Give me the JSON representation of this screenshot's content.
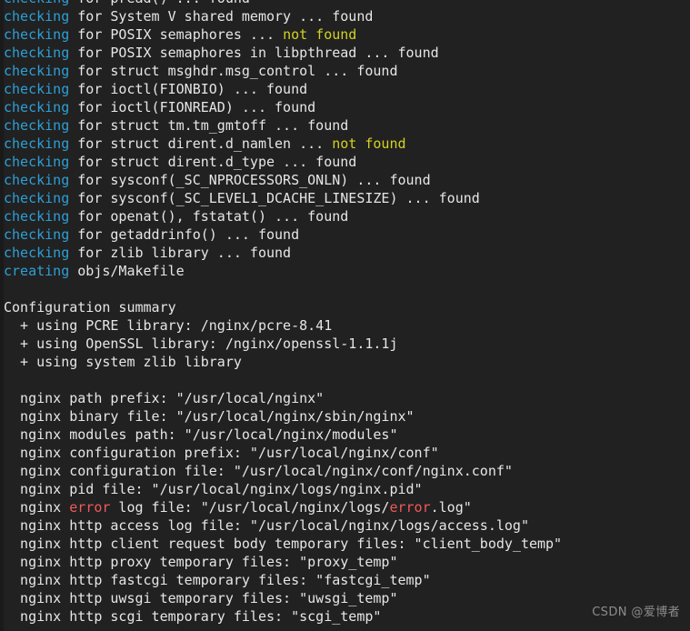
{
  "terminal": {
    "background_color": "#212121",
    "default_text_color": "#e6e6e6",
    "accent_colors": {
      "cyan": "#2d9fd6",
      "yellow": "#d2d222",
      "red": "#f05a5a",
      "watermark": "#8c8c8c"
    },
    "lines": [
      {
        "kind": "clipped",
        "segments": [
          {
            "text": "checking",
            "color": "cyan"
          },
          {
            "text": " for pread() ... found",
            "color": "default"
          }
        ]
      },
      {
        "kind": "text",
        "segments": [
          {
            "text": "checking",
            "color": "cyan"
          },
          {
            "text": " for System V shared memory ... found",
            "color": "default"
          }
        ]
      },
      {
        "kind": "text",
        "segments": [
          {
            "text": "checking",
            "color": "cyan"
          },
          {
            "text": " for POSIX semaphores ... ",
            "color": "default"
          },
          {
            "text": "not found",
            "color": "yellow"
          }
        ]
      },
      {
        "kind": "text",
        "segments": [
          {
            "text": "checking",
            "color": "cyan"
          },
          {
            "text": " for POSIX semaphores in libpthread ... found",
            "color": "default"
          }
        ]
      },
      {
        "kind": "text",
        "segments": [
          {
            "text": "checking",
            "color": "cyan"
          },
          {
            "text": " for struct msghdr.msg_control ... found",
            "color": "default"
          }
        ]
      },
      {
        "kind": "text",
        "segments": [
          {
            "text": "checking",
            "color": "cyan"
          },
          {
            "text": " for ioctl(FIONBIO) ... found",
            "color": "default"
          }
        ]
      },
      {
        "kind": "text",
        "segments": [
          {
            "text": "checking",
            "color": "cyan"
          },
          {
            "text": " for ioctl(FIONREAD) ... found",
            "color": "default"
          }
        ]
      },
      {
        "kind": "text",
        "segments": [
          {
            "text": "checking",
            "color": "cyan"
          },
          {
            "text": " for struct tm.tm_gmtoff ... found",
            "color": "default"
          }
        ]
      },
      {
        "kind": "text",
        "segments": [
          {
            "text": "checking",
            "color": "cyan"
          },
          {
            "text": " for struct dirent.d_namlen ... ",
            "color": "default"
          },
          {
            "text": "not found",
            "color": "yellow"
          }
        ]
      },
      {
        "kind": "text",
        "segments": [
          {
            "text": "checking",
            "color": "cyan"
          },
          {
            "text": " for struct dirent.d_type ... found",
            "color": "default"
          }
        ]
      },
      {
        "kind": "text",
        "segments": [
          {
            "text": "checking",
            "color": "cyan"
          },
          {
            "text": " for sysconf(_SC_NPROCESSORS_ONLN) ... found",
            "color": "default"
          }
        ]
      },
      {
        "kind": "text",
        "segments": [
          {
            "text": "checking",
            "color": "cyan"
          },
          {
            "text": " for sysconf(_SC_LEVEL1_DCACHE_LINESIZE) ... found",
            "color": "default"
          }
        ]
      },
      {
        "kind": "text",
        "segments": [
          {
            "text": "checking",
            "color": "cyan"
          },
          {
            "text": " for openat(), fstatat() ... found",
            "color": "default"
          }
        ]
      },
      {
        "kind": "text",
        "segments": [
          {
            "text": "checking",
            "color": "cyan"
          },
          {
            "text": " for getaddrinfo() ... found",
            "color": "default"
          }
        ]
      },
      {
        "kind": "text",
        "segments": [
          {
            "text": "checking",
            "color": "cyan"
          },
          {
            "text": " for zlib library ... found",
            "color": "default"
          }
        ]
      },
      {
        "kind": "text",
        "segments": [
          {
            "text": "creating",
            "color": "cyan"
          },
          {
            "text": " objs/Makefile",
            "color": "default"
          }
        ]
      },
      {
        "kind": "blank",
        "segments": []
      },
      {
        "kind": "text",
        "segments": [
          {
            "text": "Configuration summary",
            "color": "default"
          }
        ]
      },
      {
        "kind": "text",
        "segments": [
          {
            "text": "  + using PCRE library: /nginx/pcre-8.41",
            "color": "default"
          }
        ]
      },
      {
        "kind": "text",
        "segments": [
          {
            "text": "  + using OpenSSL library: /nginx/openssl-1.1.1j",
            "color": "default"
          }
        ]
      },
      {
        "kind": "text",
        "segments": [
          {
            "text": "  + using system zlib library",
            "color": "default"
          }
        ]
      },
      {
        "kind": "blank",
        "segments": []
      },
      {
        "kind": "text",
        "segments": [
          {
            "text": "  nginx path prefix: \"/usr/local/nginx\"",
            "color": "default"
          }
        ]
      },
      {
        "kind": "text",
        "segments": [
          {
            "text": "  nginx binary file: \"/usr/local/nginx/sbin/nginx\"",
            "color": "default"
          }
        ]
      },
      {
        "kind": "text",
        "segments": [
          {
            "text": "  nginx modules path: \"/usr/local/nginx/modules\"",
            "color": "default"
          }
        ]
      },
      {
        "kind": "text",
        "segments": [
          {
            "text": "  nginx configuration prefix: \"/usr/local/nginx/conf\"",
            "color": "default"
          }
        ]
      },
      {
        "kind": "text",
        "segments": [
          {
            "text": "  nginx configuration file: \"/usr/local/nginx/conf/nginx.conf\"",
            "color": "default"
          }
        ]
      },
      {
        "kind": "text",
        "segments": [
          {
            "text": "  nginx pid file: \"/usr/local/nginx/logs/nginx.pid\"",
            "color": "default"
          }
        ]
      },
      {
        "kind": "text",
        "segments": [
          {
            "text": "  nginx ",
            "color": "default"
          },
          {
            "text": "error",
            "color": "red"
          },
          {
            "text": " log file: \"/usr/local/nginx/logs/",
            "color": "default"
          },
          {
            "text": "error",
            "color": "red"
          },
          {
            "text": ".log\"",
            "color": "default"
          }
        ]
      },
      {
        "kind": "text",
        "segments": [
          {
            "text": "  nginx http access log file: \"/usr/local/nginx/logs/access.log\"",
            "color": "default"
          }
        ]
      },
      {
        "kind": "text",
        "segments": [
          {
            "text": "  nginx http client request body temporary files: \"client_body_temp\"",
            "color": "default"
          }
        ]
      },
      {
        "kind": "text",
        "segments": [
          {
            "text": "  nginx http proxy temporary files: \"proxy_temp\"",
            "color": "default"
          }
        ]
      },
      {
        "kind": "text",
        "segments": [
          {
            "text": "  nginx http fastcgi temporary files: \"fastcgi_temp\"",
            "color": "default"
          }
        ]
      },
      {
        "kind": "text",
        "segments": [
          {
            "text": "  nginx http uwsgi temporary files: \"uwsgi_temp\"",
            "color": "default"
          }
        ]
      },
      {
        "kind": "text",
        "segments": [
          {
            "text": "  nginx http scgi temporary files: \"scgi_temp\"",
            "color": "default"
          }
        ]
      }
    ]
  },
  "watermark": {
    "text": "CSDN @爱博者"
  }
}
